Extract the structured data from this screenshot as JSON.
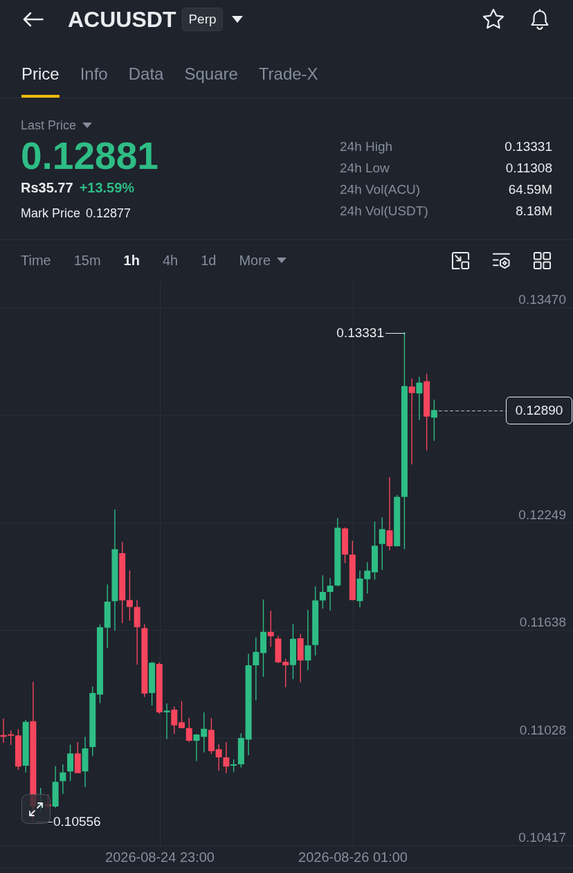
{
  "header": {
    "symbol": "ACUUSDT",
    "badge": "Perp"
  },
  "tabs": [
    {
      "label": "Price",
      "selected": true
    },
    {
      "label": "Info",
      "selected": false
    },
    {
      "label": "Data",
      "selected": false
    },
    {
      "label": "Square",
      "selected": false
    },
    {
      "label": "Trade-X",
      "selected": false
    }
  ],
  "ticker": {
    "last_price_label": "Last Price",
    "last_price": "0.12881",
    "rising": true,
    "fiat_price": "Rs35.77",
    "change": "+13.59%",
    "mark_price_label": "Mark Price",
    "mark_price": "0.12877"
  },
  "stats": [
    {
      "label": "24h High",
      "value": "0.13331"
    },
    {
      "label": "24h Low",
      "value": "0.11308"
    },
    {
      "label": "24h Vol(ACU)",
      "value": "64.59M"
    },
    {
      "label": "24h Vol(USDT)",
      "value": "8.18M"
    }
  ],
  "intervals": [
    {
      "label": "Time",
      "kind": "option",
      "selected": false
    },
    {
      "label": "15m",
      "kind": "option",
      "selected": false
    },
    {
      "label": "1h",
      "kind": "option",
      "selected": true
    },
    {
      "label": "4h",
      "kind": "option",
      "selected": false
    },
    {
      "label": "1d",
      "kind": "option",
      "selected": false
    },
    {
      "label": "More",
      "kind": "menu",
      "selected": false
    }
  ],
  "chart": {
    "price_axis": [
      "0.13470",
      "0.12249",
      "0.11638",
      "0.11028",
      "0.10417"
    ],
    "last_price_tag": "0.12890",
    "high_label": "0.13331",
    "low_label": "0.10556",
    "time_axis": [
      "2026-08-24 23:00",
      "2026-08-26 01:00"
    ]
  }
}
